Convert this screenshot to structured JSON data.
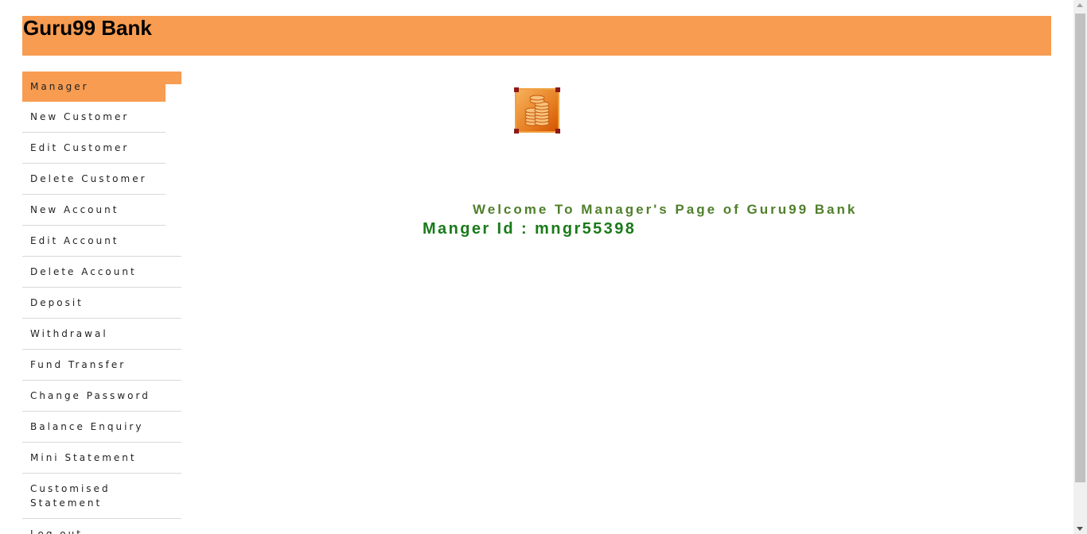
{
  "header": {
    "title": "Guru99 Bank"
  },
  "menu": {
    "items": [
      {
        "label": "Manager"
      },
      {
        "label": "New Customer"
      },
      {
        "label": "Edit Customer"
      },
      {
        "label": "Delete Customer"
      },
      {
        "label": "New Account"
      },
      {
        "label": "Edit Account"
      },
      {
        "label": "Delete Account"
      },
      {
        "label": "Deposit"
      },
      {
        "label": "Withdrawal"
      },
      {
        "label": "Fund Transfer"
      },
      {
        "label": "Change Password"
      },
      {
        "label": "Balance Enquiry"
      },
      {
        "label": "Mini Statement"
      },
      {
        "label": "Customised Statement"
      },
      {
        "label": "Log out"
      }
    ]
  },
  "main": {
    "logo_icon": "coin-stack-icon",
    "welcome": "Welcome To Manager's Page of Guru99 Bank",
    "manager_id": "Manger Id : mngr55398"
  },
  "colors": {
    "header_bg": "#f79c51",
    "welcome_text": "#4f7f2a",
    "manager_id_text": "#1a7a1a"
  }
}
